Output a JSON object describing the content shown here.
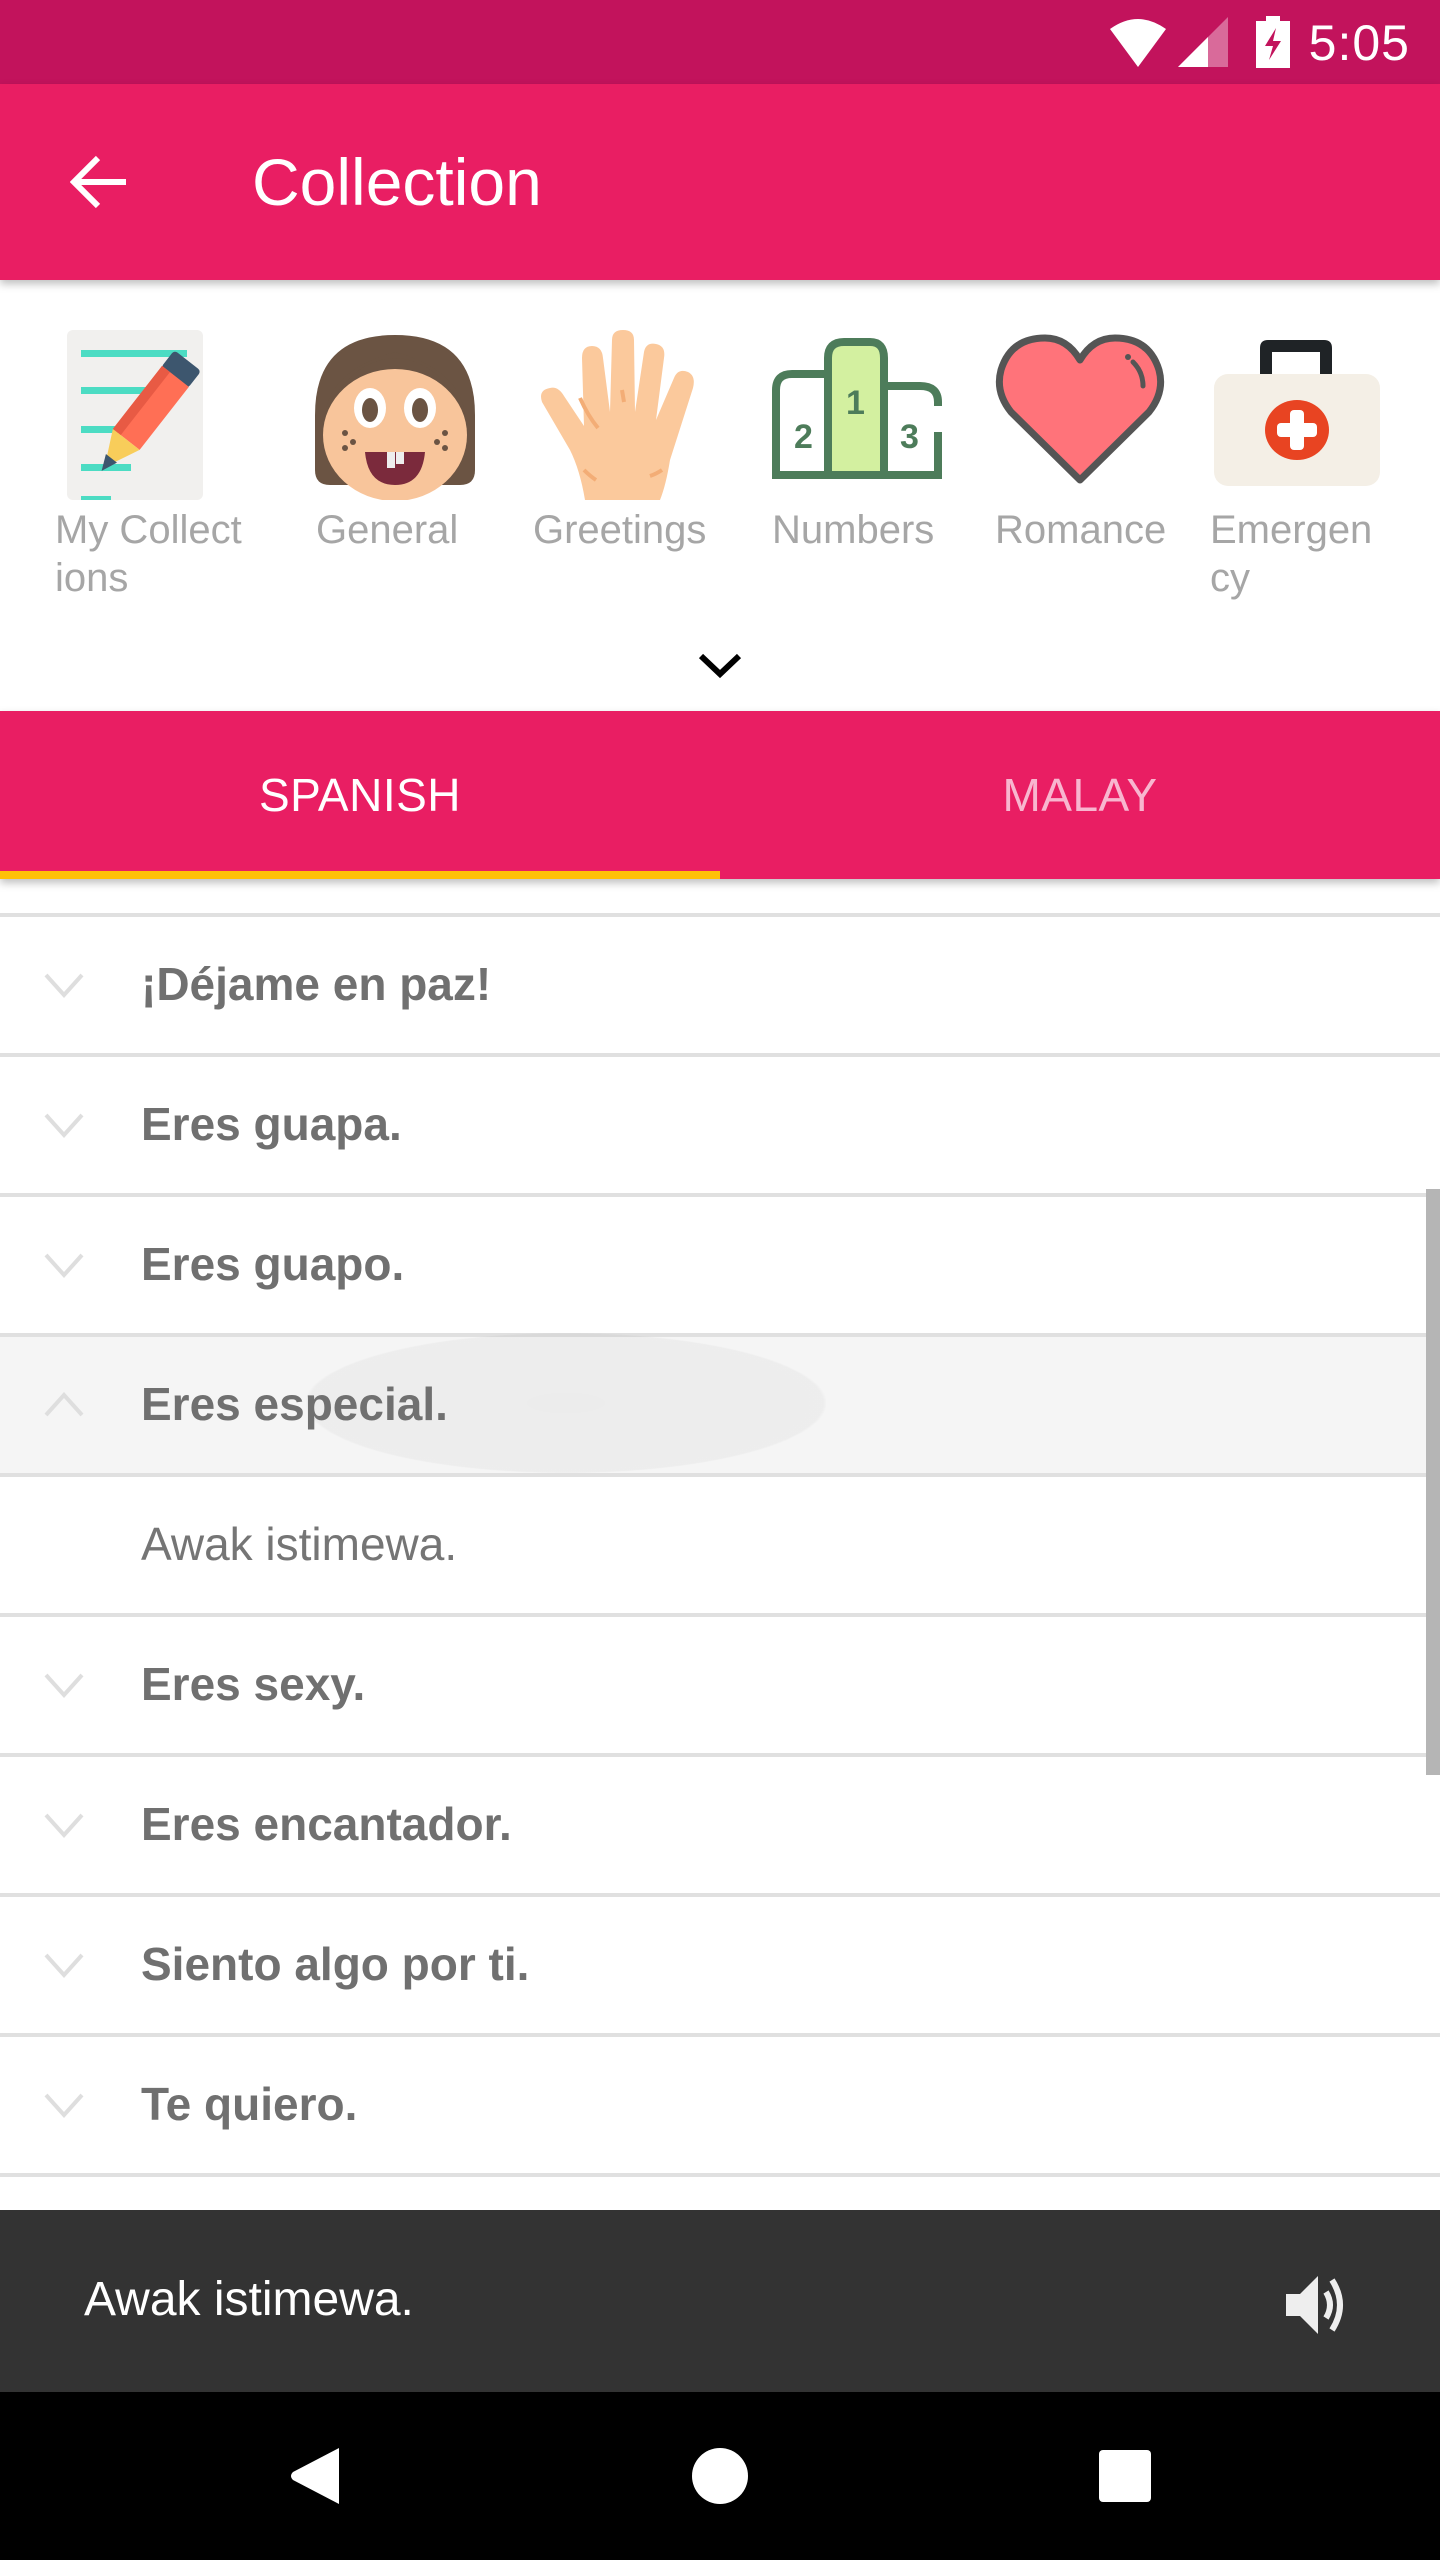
{
  "status_bar": {
    "time": "5:05",
    "icons": [
      "wifi-icon",
      "signal-icon",
      "battery-charging-icon"
    ],
    "color": "#c2135c"
  },
  "toolbar": {
    "title": "Collection",
    "back_icon": "arrow-back-icon",
    "color": "#e91e63"
  },
  "categories": [
    {
      "label": "My Collect ions",
      "icon": "notepad-pencil-icon"
    },
    {
      "label": "General",
      "icon": "girl-face-icon"
    },
    {
      "label": "Greetings",
      "icon": "waving-hand-icon"
    },
    {
      "label": "Numbers",
      "icon": "podium-icon"
    },
    {
      "label": "Romance",
      "icon": "heart-icon"
    },
    {
      "label": "Emergen cy",
      "icon": "first-aid-kit-icon"
    }
  ],
  "expand_icon": "chevron-down-icon",
  "tabs": [
    {
      "label": "SPANISH",
      "active": true
    },
    {
      "label": "MALAY",
      "active": false
    }
  ],
  "tab_indicator_color": "#ffc107",
  "phrases": [
    {
      "text": "¡Déjame en paz!",
      "expanded": false
    },
    {
      "text": "Eres guapa.",
      "expanded": false
    },
    {
      "text": "Eres guapo.",
      "expanded": false
    },
    {
      "text": "Eres especial.",
      "expanded": true,
      "translation": "Awak istimewa."
    },
    {
      "text": "Eres sexy.",
      "expanded": false
    },
    {
      "text": "Eres encantador.",
      "expanded": false
    },
    {
      "text": "Siento algo por ti.",
      "expanded": false
    },
    {
      "text": "Te quiero.",
      "expanded": false
    }
  ],
  "player": {
    "text": "Awak istimewa.",
    "icon": "speaker-icon"
  },
  "navbar": {
    "buttons": [
      "back-triangle-icon",
      "home-circle-icon",
      "recents-square-icon"
    ]
  }
}
